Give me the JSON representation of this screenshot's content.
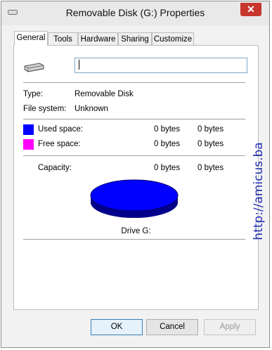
{
  "window": {
    "title": "Removable Disk (G:) Properties",
    "close_label": "✕"
  },
  "tabs": [
    {
      "label": "General",
      "active": true
    },
    {
      "label": "Tools"
    },
    {
      "label": "Hardware"
    },
    {
      "label": "Sharing"
    },
    {
      "label": "Customize"
    }
  ],
  "general": {
    "name_value": "",
    "type_label": "Type:",
    "type_value": "Removable Disk",
    "fs_label": "File system:",
    "fs_value": "Unknown",
    "used_label": "Used space:",
    "used_bytes": "0 bytes",
    "used_size": "0 bytes",
    "free_label": "Free space:",
    "free_bytes": "0 bytes",
    "free_size": "0 bytes",
    "capacity_label": "Capacity:",
    "capacity_bytes": "0 bytes",
    "capacity_size": "0 bytes",
    "drive_label": "Drive G:"
  },
  "colors": {
    "used": "#0000ff",
    "free": "#ff00ff"
  },
  "buttons": {
    "ok": "OK",
    "cancel": "Cancel",
    "apply": "Apply"
  },
  "watermark": "http://amicus.ba"
}
